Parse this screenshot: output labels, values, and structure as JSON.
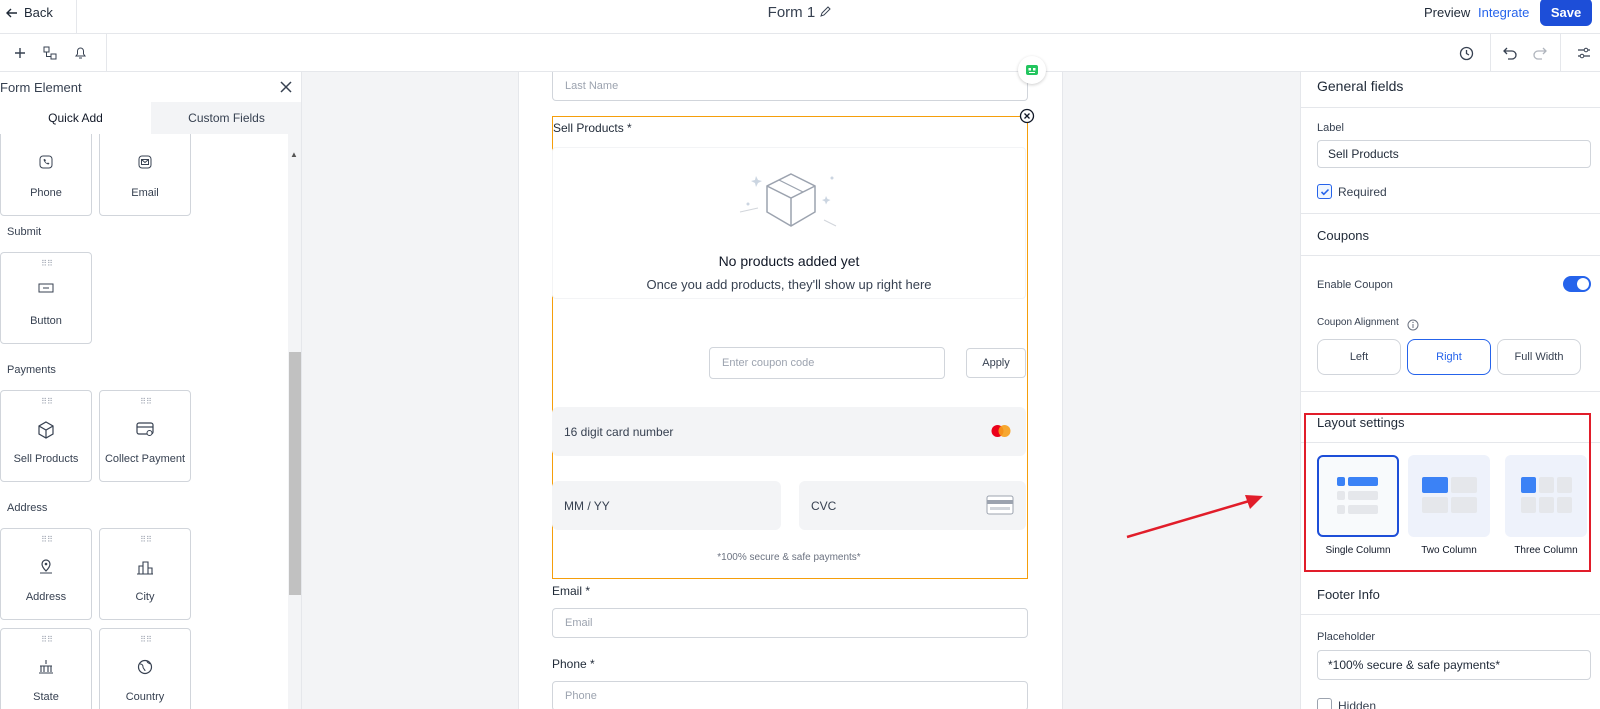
{
  "topbar": {
    "back_label": "Back",
    "form_title": "Form 1",
    "preview_label": "Preview",
    "integrate_label": "Integrate",
    "save_label": "Save"
  },
  "left_panel": {
    "title": "Form Element",
    "tabs": [
      "Quick Add",
      "Custom Fields"
    ],
    "sections": {
      "submit": "Submit",
      "payments": "Payments",
      "address": "Address"
    },
    "cards": {
      "phone": "Phone",
      "email": "Email",
      "button": "Button",
      "sell_products": "Sell Products",
      "collect_payment": "Collect Payment",
      "address": "Address",
      "city": "City",
      "state": "State",
      "country": "Country"
    }
  },
  "form": {
    "last_name_placeholder": "Last Name",
    "sell_products_label": "Sell Products *",
    "empty_title": "No products added yet",
    "empty_subtitle": "Once you add products, they'll show up right here",
    "coupon_placeholder": "Enter coupon code",
    "apply_label": "Apply",
    "card_number_placeholder": "16 digit card number",
    "expiry_placeholder": "MM / YY",
    "cvc_placeholder": "CVC",
    "secure_text": "*100% secure & safe payments*",
    "email_label": "Email *",
    "email_placeholder": "Email",
    "phone_label": "Phone *",
    "phone_placeholder": "Phone"
  },
  "right_panel": {
    "general_fields": "General fields",
    "label_caption": "Label",
    "label_value": "Sell Products",
    "required_label": "Required",
    "required_checked": true,
    "coupons_heading": "Coupons",
    "enable_coupon_label": "Enable Coupon",
    "enable_coupon_on": true,
    "coupon_alignment_label": "Coupon Alignment",
    "alignment_options": [
      "Left",
      "Right",
      "Full Width"
    ],
    "alignment_selected": "Right",
    "layout_settings": "Layout settings",
    "layout_options": [
      "Single Column",
      "Two Column",
      "Three Column"
    ],
    "layout_selected": "Single Column",
    "footer_info": "Footer Info",
    "placeholder_caption": "Placeholder",
    "placeholder_value": "*100% secure & safe payments*",
    "hidden_label": "Hidden"
  },
  "colors": {
    "primary": "#1d4ed8",
    "selection_outline": "#f59e0b",
    "annotation": "#e11d2a"
  }
}
